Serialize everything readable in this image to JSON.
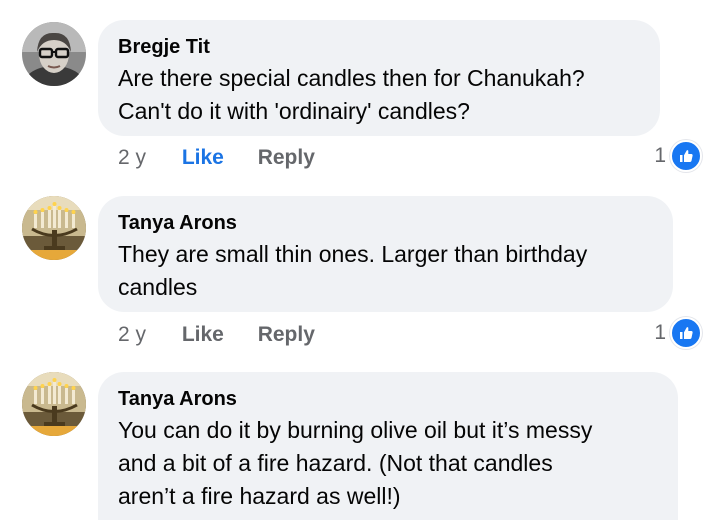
{
  "comments": [
    {
      "author": "Bregje Tit",
      "text": "Are there special candles then for Chanukah?\nCan't do it with 'ordinairy' candles?",
      "age": "2 y",
      "like_label": "Like",
      "reply_label": "Reply",
      "like_active": true,
      "reaction_count": "1",
      "avatar_icon": "person-with-glasses-avatar"
    },
    {
      "author": "Tanya Arons",
      "text": "They are small thin ones.  Larger than birthday\ncandles",
      "age": "2 y",
      "like_label": "Like",
      "reply_label": "Reply",
      "like_active": false,
      "reaction_count": "1",
      "avatar_icon": "menorah-candles-avatar"
    },
    {
      "author": "Tanya Arons",
      "text": "You can do it by burning olive oil but it’s messy\nand a bit of a fire hazard.  (Not that candles\naren’t a fire hazard as well!)",
      "avatar_icon": "menorah-candles-avatar"
    }
  ],
  "colors": {
    "bubble": "#f0f2f5",
    "like_active": "#1b74e4",
    "muted": "#65676b",
    "reaction_badge": "#1877f2"
  },
  "icons": {
    "reaction": "thumbs-up-icon"
  }
}
